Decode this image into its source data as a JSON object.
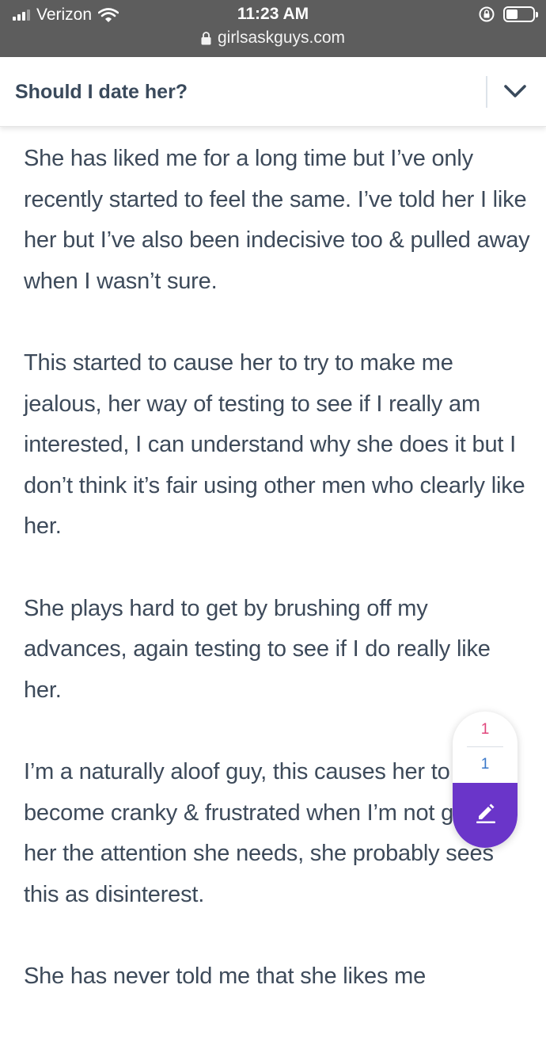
{
  "status": {
    "carrier": "Verizon",
    "time": "11:23 AM",
    "url": "girlsaskguys.com"
  },
  "question": {
    "title": "Should I date her?"
  },
  "body": {
    "paragraphs": [
      "She has liked me for a long time but I’ve only recently started to feel the same. I’ve told her I like her but I’ve also been indecisive too & pulled away when I wasn’t sure.",
      "This started to cause her to try to make me jealous, her way of testing to see if I really am interested, I can understand why she does it but I don’t think it’s fair using other men who clearly like her.",
      "She plays hard to get by brushing off my advances, again testing to see if I do really like her.",
      "I’m a naturally aloof guy, this causes her to become cranky & frustrated when I’m not giving her the attention she needs, she probably sees this as disinterest.",
      "She has never told me that she likes me"
    ]
  },
  "widget": {
    "top_count": "1",
    "bottom_count": "1",
    "top_color": "#e0457b",
    "bottom_color": "#3a78c9",
    "button_color": "#6a35c9",
    "button_icon": "pencil-icon"
  }
}
